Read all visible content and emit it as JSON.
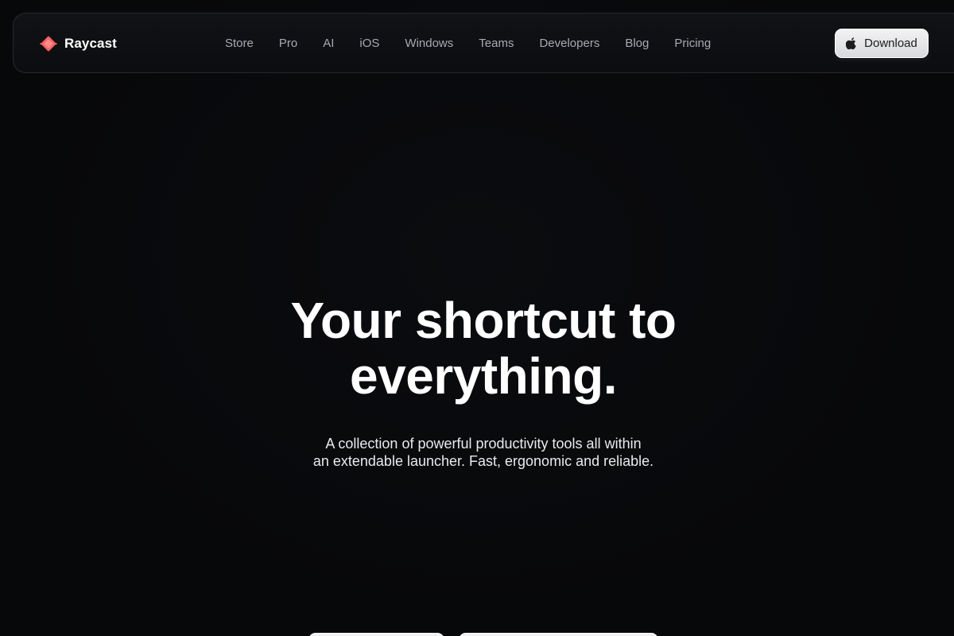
{
  "brand": {
    "name": "Raycast",
    "accent_color": "#ff6363",
    "logo_icon": "raycast-logo-icon"
  },
  "nav": {
    "links": [
      "Store",
      "Pro",
      "AI",
      "iOS",
      "Windows",
      "Teams",
      "Developers",
      "Blog",
      "Pricing"
    ]
  },
  "download": {
    "label": "Download",
    "icon": "apple-icon"
  },
  "hero": {
    "title_line1": "Your shortcut to",
    "title_line2": "everything.",
    "subtitle_line1": "A collection of powerful productivity tools all within",
    "subtitle_line2": "an extendable launcher. Fast, ergonomic and reliable."
  },
  "colors": {
    "background": "#07080a",
    "nav_link": "#a8aab1",
    "button_bg": "#e6e7e9",
    "button_text": "#1b1c1f"
  }
}
